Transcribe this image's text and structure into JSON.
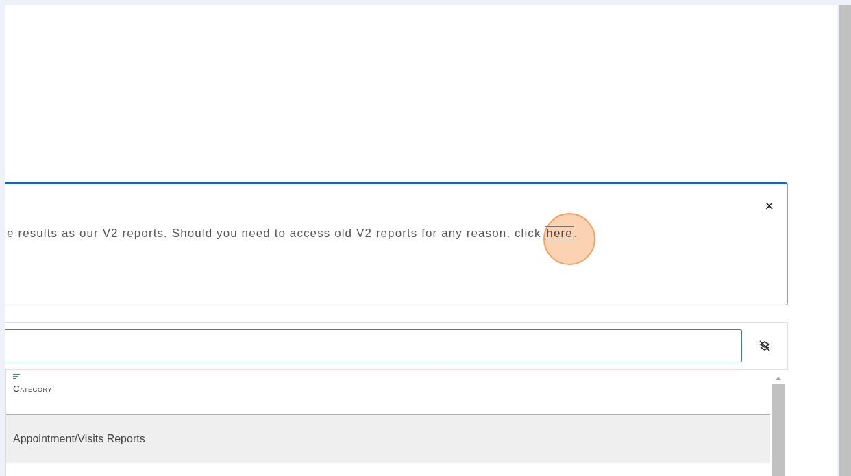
{
  "alert": {
    "message": "e results as our V2 reports. Should you need to access old V2 reports for any reason, click ",
    "link": "here",
    "after_link": ".",
    "close": "×"
  },
  "table": {
    "columns": [
      {
        "label": "Category",
        "sorted": true
      }
    ],
    "rows": [
      {
        "cells": [
          "Appointment/Visits Reports"
        ],
        "selected": true
      }
    ]
  }
}
